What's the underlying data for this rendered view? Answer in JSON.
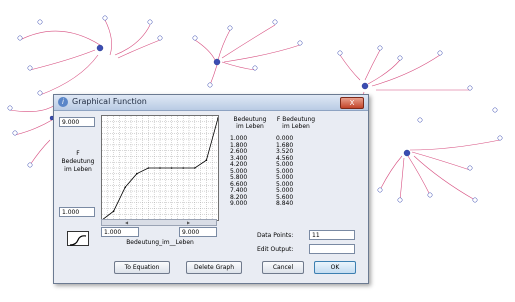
{
  "dialog": {
    "title": "Graphical Function",
    "close_label": "X",
    "y_max": "9.000",
    "y_min": "1.000",
    "x_min": "1.000",
    "x_max": "9.000",
    "y_axis_label": [
      "F",
      "Bedeutung",
      "im Leben"
    ],
    "x_axis_label": "Bedeutung_im__Leben",
    "table": {
      "headers": [
        "Bedeutung im Leben",
        "F Bedeutung im Leben"
      ],
      "rows": [
        [
          "1.000",
          "0.000"
        ],
        [
          "1.800",
          "1.680"
        ],
        [
          "2.600",
          "3.520"
        ],
        [
          "3.400",
          "4.560"
        ],
        [
          "4.200",
          "5.000"
        ],
        [
          "5.000",
          "5.000"
        ],
        [
          "5.800",
          "5.000"
        ],
        [
          "6.600",
          "5.000"
        ],
        [
          "7.400",
          "5.000"
        ],
        [
          "8.200",
          "5.600"
        ],
        [
          "9.000",
          "8.840"
        ]
      ]
    },
    "data_points_label": "Data Points:",
    "data_points_value": "11",
    "edit_output_label": "Edit Output:",
    "edit_output_value": "",
    "buttons": {
      "to_equation": "To Equation",
      "delete_graph": "Delete Graph",
      "cancel": "Cancel",
      "ok": "OK"
    }
  },
  "chart_data": {
    "type": "line",
    "x": [
      1.0,
      1.8,
      2.6,
      3.4,
      4.2,
      5.0,
      5.8,
      6.6,
      7.4,
      8.2,
      9.0
    ],
    "y": [
      0.0,
      1.68,
      3.52,
      4.56,
      5.0,
      5.0,
      5.0,
      5.0,
      5.0,
      5.6,
      8.84
    ],
    "xlim": [
      1.0,
      9.0
    ],
    "ylim": [
      1.0,
      9.0
    ],
    "grid": true
  }
}
